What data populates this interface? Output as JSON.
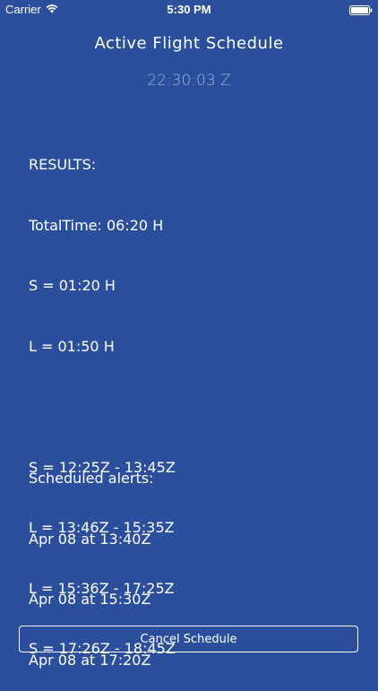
{
  "status_bar": {
    "carrier": "Carrier",
    "time": "5:30 PM",
    "icons": [
      "wifi-icon",
      "battery-icon"
    ]
  },
  "header": {
    "title": "Active Flight Schedule",
    "clock": "22:30:03 Z"
  },
  "results": {
    "heading": "RESULTS:",
    "total_time": "TotalTime: 06:20 H",
    "summary": [
      "S = 01:20 H",
      "L = 01:50 H"
    ],
    "schedule": [
      "S = 12:25Z - 13:45Z",
      "L = 13:46Z - 15:35Z",
      "L = 15:36Z - 17:25Z",
      "S = 17:26Z - 18:45Z"
    ]
  },
  "alerts": {
    "heading": "Scheduled alerts:",
    "items": [
      "Apr 08 at 13:40Z",
      "Apr 08 at 15:30Z",
      "Apr 08 at 17:20Z"
    ]
  },
  "actions": {
    "cancel_label": "Cancel Schedule"
  },
  "colors": {
    "background": "#2b4f9d",
    "text": "#ffffff",
    "clock": "#9fb1d6"
  }
}
